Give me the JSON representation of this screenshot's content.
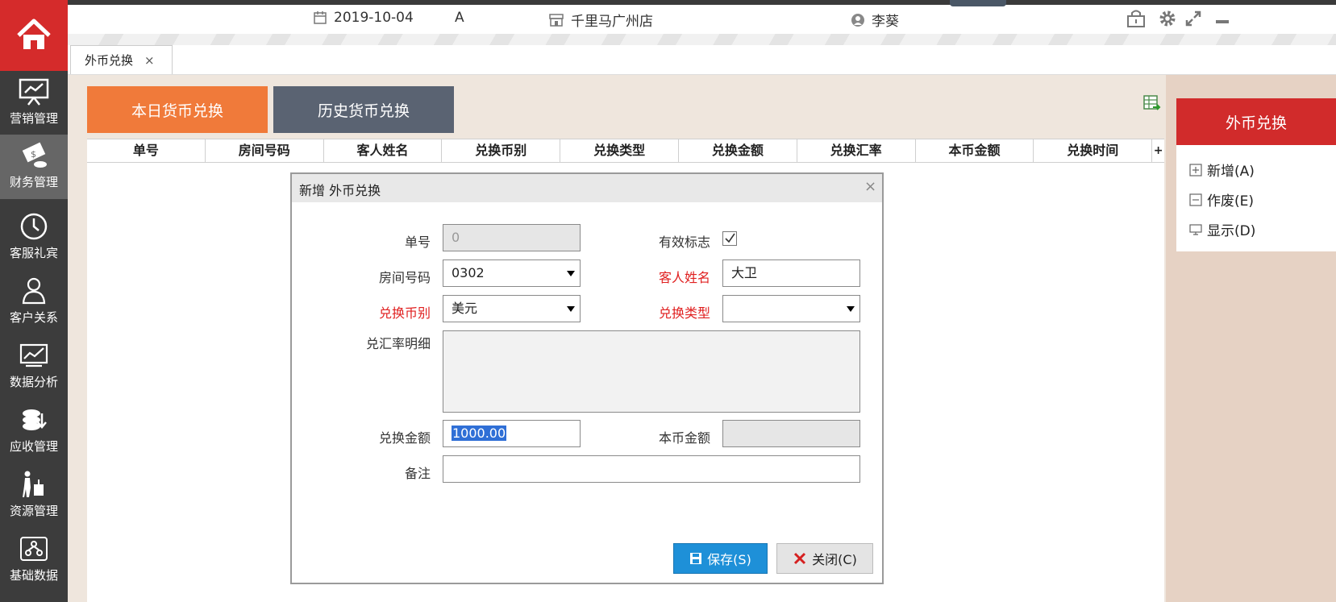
{
  "topbar": {
    "date": "2019-10-04",
    "shift": "A",
    "store": "千里马广州店",
    "user": "李葵",
    "icons": [
      "calendar-icon",
      "store-icon",
      "user-icon",
      "lock-icon",
      "gear-icon",
      "fullscreen-icon",
      "minimize-icon"
    ]
  },
  "sidebar": {
    "items": [
      {
        "label": "营销管理",
        "icon": "presentation-icon"
      },
      {
        "label": "财务管理",
        "icon": "money-icon"
      },
      {
        "label": "客服礼宾",
        "icon": "clock-icon"
      },
      {
        "label": "客户关系",
        "icon": "users-icon"
      },
      {
        "label": "数据分析",
        "icon": "chart-icon"
      },
      {
        "label": "应收管理",
        "icon": "coins-icon"
      },
      {
        "label": "资源管理",
        "icon": "luggage-icon"
      },
      {
        "label": "基础数据",
        "icon": "network-icon"
      }
    ],
    "active_index": 1
  },
  "tab": {
    "label": "外币兑换",
    "close": "×"
  },
  "main": {
    "today_button": "本日货币兑换",
    "history_button": "历史货币兑换",
    "columns": [
      "单号",
      "房间号码",
      "客人姓名",
      "兑换币别",
      "兑换类型",
      "兑换金额",
      "兑换汇率",
      "本币金额",
      "兑换时间"
    ],
    "column_add": "+"
  },
  "panel": {
    "title": "外币兑换",
    "items": [
      {
        "label": "新增(A)",
        "icon": "plus-box-icon"
      },
      {
        "label": "作废(E)",
        "icon": "minus-box-icon"
      },
      {
        "label": "显示(D)",
        "icon": "monitor-icon"
      }
    ]
  },
  "dialog": {
    "title": "新增 外币兑换",
    "close": "×",
    "labels": {
      "order_no": "单号",
      "valid_flag": "有效标志",
      "room_no": "房间号码",
      "guest_name": "客人姓名",
      "currency": "兑换币别",
      "exchange_type": "兑换类型",
      "rate_detail": "兑汇率明细",
      "amount": "兑换金额",
      "local_amount": "本币金额",
      "remark": "备注"
    },
    "values": {
      "order_no": "0",
      "valid_flag_checked": true,
      "room_no": "0302",
      "guest_name": "大卫",
      "currency": "美元",
      "exchange_type": "",
      "rate_detail": "",
      "amount": "1000.00",
      "local_amount": "",
      "remark": ""
    },
    "save_button": "保存(S)",
    "close_button": "关闭(C)"
  },
  "colors": {
    "brand_red": "#d52b2b",
    "orange": "#f07a3a",
    "slate": "#5a6372",
    "save_blue": "#1e90d8",
    "required_red": "#e02020"
  }
}
